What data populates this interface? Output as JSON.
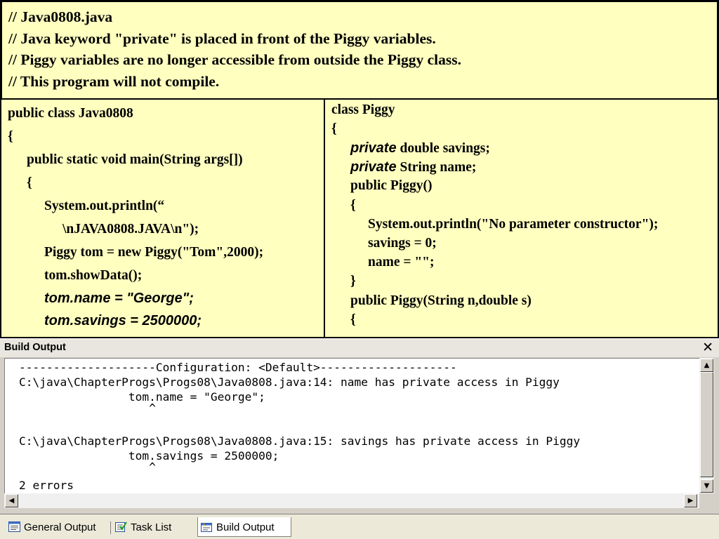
{
  "header": {
    "lines": [
      "// Java0808.java",
      "// Java keyword \"private\" is placed in front of the Piggy variables.",
      "// Piggy variables are no longer accessible from outside the Piggy class.",
      "// This program will not compile."
    ]
  },
  "left_code": [
    "public class Java0808",
    "{",
    "public static void main(String args[])",
    "{",
    "System.out.println(“",
    "\\nJAVA0808.JAVA\\n\");",
    "Piggy tom = new Piggy(\"Tom\",2000);",
    "tom.showData();",
    "tom.name = \"George\";",
    "tom.savings = 2500000;"
  ],
  "right_code": {
    "line0": "class Piggy",
    "line1": "{",
    "private_kw": "private",
    "line2_rest": "double savings;",
    "line3_rest": "String name;",
    "line4": "public Piggy()",
    "line5": "{",
    "line6": "System.out.println(\"No parameter constructor\");",
    "line7": "savings = 0;",
    "line8": "name = \"\";",
    "line9": "}",
    "line10": "public Piggy(String n,double s)",
    "line11": "{"
  },
  "build_output": {
    "title": "Build Output",
    "lines": [
      "--------------------Configuration: <Default>--------------------",
      "C:\\java\\ChapterProgs\\Progs08\\Java0808.java:14: name has private access in Piggy",
      "                tom.name = \"George\";",
      "                   ^",
      "",
      "C:\\java\\ChapterProgs\\Progs08\\Java0808.java:15: savings has private access in Piggy",
      "                tom.savings = 2500000;",
      "                   ^",
      "",
      "2 errors"
    ]
  },
  "tabs": [
    {
      "label": "General Output",
      "icon": "general-output-icon"
    },
    {
      "label": "Task List",
      "icon": "task-list-icon"
    },
    {
      "label": "Build Output",
      "icon": "build-output-icon"
    }
  ],
  "colors": {
    "slide_background": "#ffffc0",
    "window_chrome": "#d4d0c8"
  }
}
